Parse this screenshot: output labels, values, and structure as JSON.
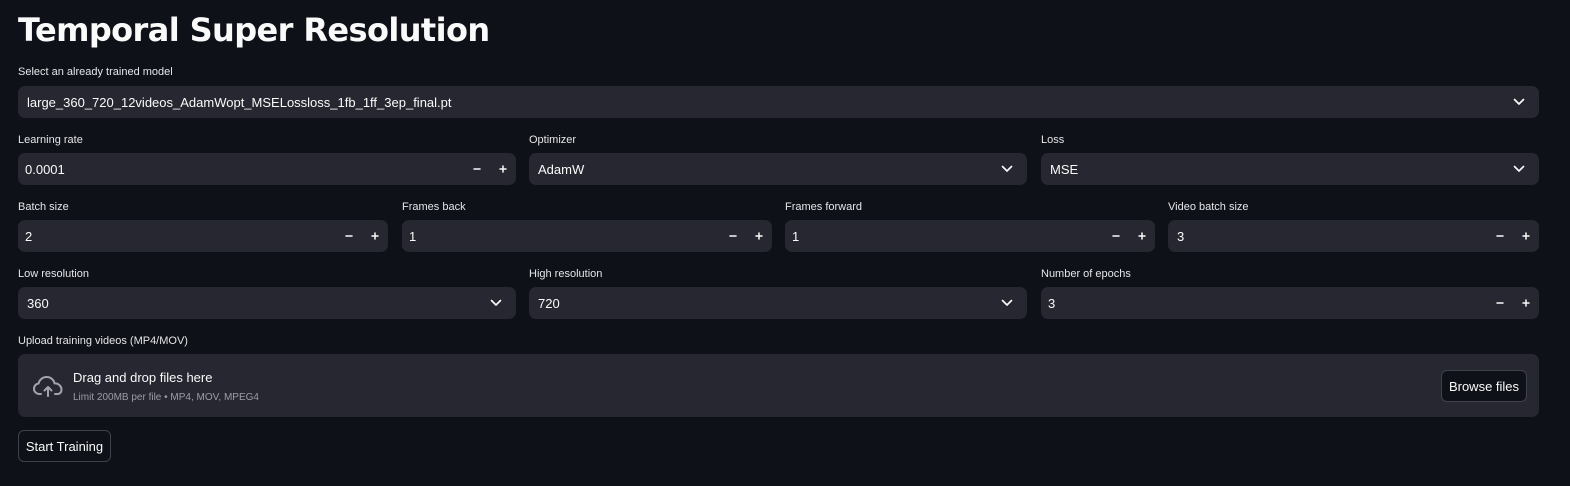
{
  "page": {
    "title": "Temporal Super Resolution"
  },
  "model_select": {
    "label": "Select an already trained model",
    "value": "large_360_720_12videos_AdamWopt_MSELossloss_1fb_1ff_3ep_final.pt"
  },
  "learning_rate": {
    "label": "Learning rate",
    "value": "0.0001"
  },
  "optimizer": {
    "label": "Optimizer",
    "value": "AdamW"
  },
  "loss": {
    "label": "Loss",
    "value": "MSE"
  },
  "batch_size": {
    "label": "Batch size",
    "value": "2"
  },
  "frames_back": {
    "label": "Frames back",
    "value": "1"
  },
  "frames_forward": {
    "label": "Frames forward",
    "value": "1"
  },
  "video_batch_size": {
    "label": "Video batch size",
    "value": "3"
  },
  "low_resolution": {
    "label": "Low resolution",
    "value": "360"
  },
  "high_resolution": {
    "label": "High resolution",
    "value": "720"
  },
  "num_epochs": {
    "label": "Number of epochs",
    "value": "3"
  },
  "uploader": {
    "label": "Upload training videos (MP4/MOV)",
    "title": "Drag and drop files here",
    "limit_text": "Limit 200MB per file • MP4, MOV, MPEG4",
    "browse_label": "Browse files",
    "icon": "cloud-upload-icon"
  },
  "start_button": {
    "label": "Start Training"
  },
  "icons": {
    "chevron": "chevron-down-icon",
    "minus": "minus-icon",
    "plus": "plus-icon"
  },
  "colors": {
    "background": "#0e1117",
    "field": "#262730",
    "text": "#fafafa",
    "muted": "#9b9ca5"
  }
}
